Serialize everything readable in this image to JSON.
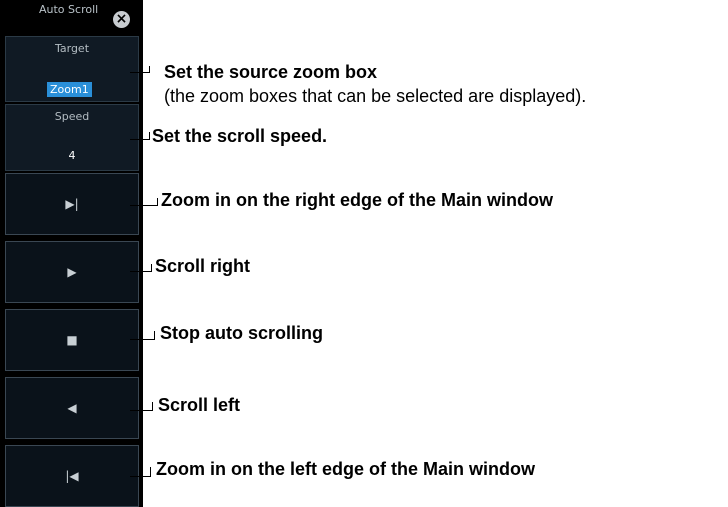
{
  "panel": {
    "title": "Auto Scroll",
    "close_icon": "close-circle-icon",
    "target_label": "Target",
    "target_value": "Zoom1",
    "speed_label": "Speed",
    "speed_value": "4",
    "buttons": [
      {
        "icon": "skip-to-end-icon",
        "glyph": "▶|"
      },
      {
        "icon": "play-right-icon",
        "glyph": "▶"
      },
      {
        "icon": "stop-icon",
        "glyph": "■"
      },
      {
        "icon": "play-left-icon",
        "glyph": "◀"
      },
      {
        "icon": "skip-to-start-icon",
        "glyph": "|◀"
      }
    ]
  },
  "annotations": {
    "target_title": "Set the source zoom box",
    "target_note": "(the zoom boxes that can be selected are displayed).",
    "speed": "Set the scroll speed.",
    "right_edge": "Zoom in on the right edge of the Main window",
    "scroll_right": "Scroll right",
    "stop": "Stop auto scrolling",
    "scroll_left": "Scroll left",
    "left_edge": "Zoom in on the left edge of the Main window"
  },
  "colors": {
    "panel_bg": "#000000",
    "selected": "#2a8fd8",
    "text": "#c8cfd4"
  }
}
